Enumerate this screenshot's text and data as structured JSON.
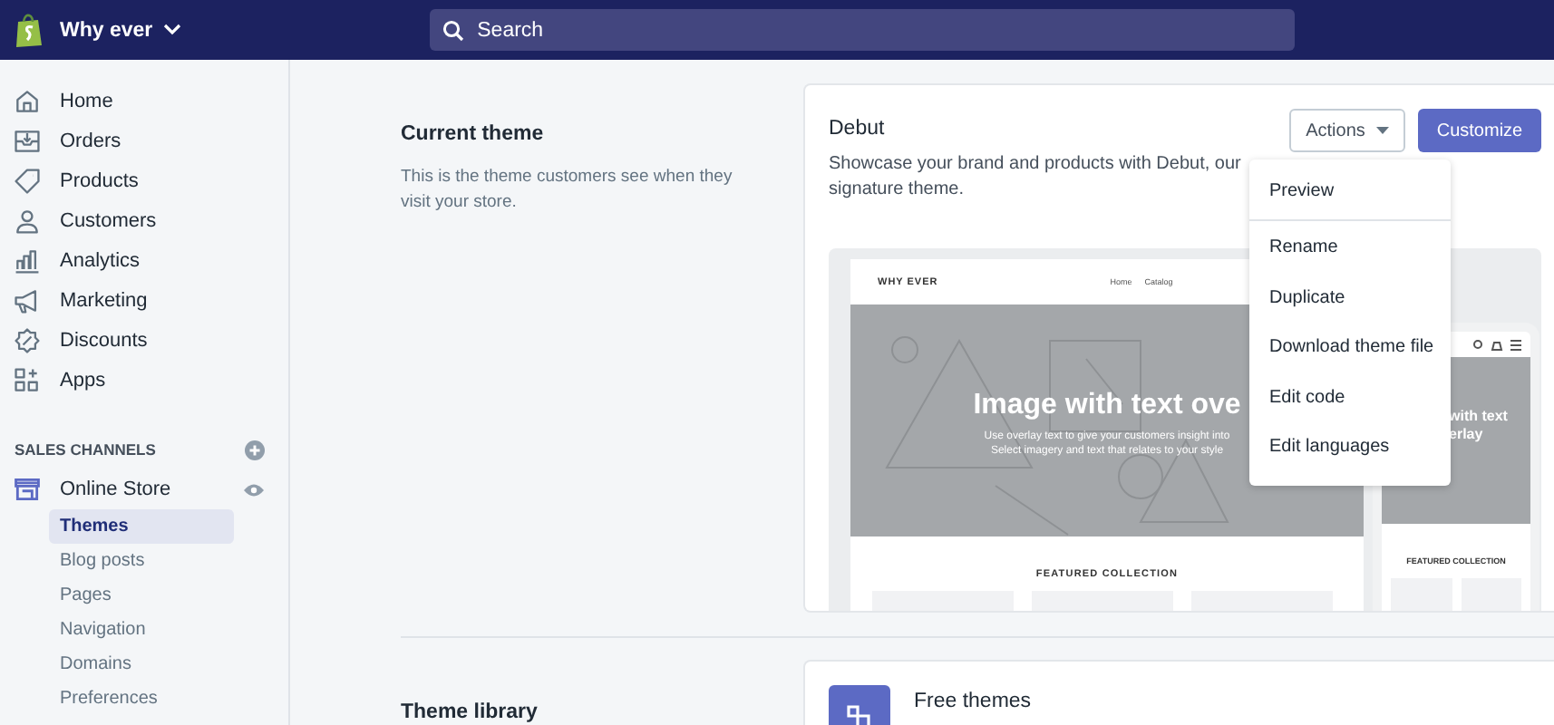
{
  "topbar": {
    "store_name": "Why ever",
    "search": {
      "placeholder": "Search"
    }
  },
  "sidebar": {
    "items": [
      {
        "label": "Home"
      },
      {
        "label": "Orders"
      },
      {
        "label": "Products"
      },
      {
        "label": "Customers"
      },
      {
        "label": "Analytics"
      },
      {
        "label": "Marketing"
      },
      {
        "label": "Discounts"
      },
      {
        "label": "Apps"
      }
    ],
    "sales_channels": {
      "heading": "SALES CHANNELS",
      "channel": "Online Store",
      "sub_items": [
        {
          "label": "Themes",
          "selected": true
        },
        {
          "label": "Blog posts",
          "selected": false
        },
        {
          "label": "Pages",
          "selected": false
        },
        {
          "label": "Navigation",
          "selected": false
        },
        {
          "label": "Domains",
          "selected": false
        },
        {
          "label": "Preferences",
          "selected": false
        }
      ]
    }
  },
  "current_theme": {
    "title": "Current theme",
    "description": "This is the theme customers see when they visit your store.",
    "card": {
      "name": "Debut",
      "description": "Showcase your brand and products with Debut, our signature theme.",
      "actions_button": "Actions",
      "customize_button": "Customize",
      "actions_menu": [
        "Preview",
        "Rename",
        "Duplicate",
        "Download theme file",
        "Edit code",
        "Edit languages"
      ],
      "preview": {
        "store_name": "WHY EVER",
        "nav": [
          "Home",
          "Catalog"
        ],
        "hero_title": "Image with text ove",
        "hero_text": [
          "Use overlay text to give your customers insight into",
          "Select imagery and text that relates to your style"
        ],
        "featured_title": "FEATURED COLLECTION",
        "mobile": {
          "hero_title": [
            "with text",
            "erlay"
          ],
          "featured_title": "FEATURED COLLECTION"
        }
      }
    }
  },
  "theme_library": {
    "title": "Theme library",
    "card": {
      "title": "Free themes"
    }
  }
}
